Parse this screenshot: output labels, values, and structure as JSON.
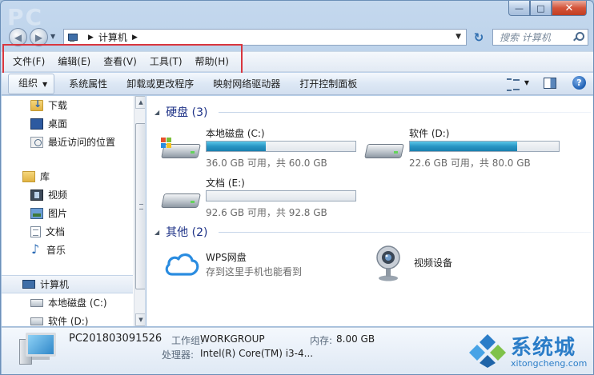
{
  "window": {
    "logo_text": "PC",
    "caption": {
      "minimize": "—",
      "maximize": "□",
      "close": "✕"
    }
  },
  "address": {
    "path": "计算机",
    "search_placeholder": "搜索 计算机"
  },
  "menu": [
    "文件(F)",
    "编辑(E)",
    "查看(V)",
    "工具(T)",
    "帮助(H)"
  ],
  "toolbar": {
    "organize": "组织",
    "commands": [
      "系统属性",
      "卸载或更改程序",
      "映射网络驱动器",
      "打开控制面板"
    ]
  },
  "nav": {
    "favorites": [
      {
        "label": "下载",
        "icon": "download-folder-icon"
      },
      {
        "label": "桌面",
        "icon": "desktop-icon"
      },
      {
        "label": "最近访问的位置",
        "icon": "recent-places-icon"
      }
    ],
    "library": {
      "label": "库",
      "icon": "library-icon"
    },
    "libraries": [
      {
        "label": "视频",
        "icon": "video-library-icon"
      },
      {
        "label": "图片",
        "icon": "pictures-library-icon"
      },
      {
        "label": "文档",
        "icon": "documents-library-icon"
      },
      {
        "label": "音乐",
        "icon": "music-library-icon"
      }
    ],
    "computer": {
      "label": "计算机",
      "icon": "computer-icon"
    },
    "drives": [
      {
        "label": "本地磁盘 (C:)",
        "icon": "drive-icon"
      },
      {
        "label": "软件 (D:)",
        "icon": "drive-icon"
      }
    ]
  },
  "groups": {
    "hard_disks": {
      "title": "硬盘 (3)"
    },
    "other": {
      "title": "其他 (2)"
    }
  },
  "drives": [
    {
      "name": "本地磁盘 (C:)",
      "free_text": "36.0 GB 可用，共 60.0 GB",
      "used_fraction": 0.4,
      "system": true
    },
    {
      "name": "软件 (D:)",
      "free_text": "22.6 GB 可用，共 80.0 GB",
      "used_fraction": 0.72,
      "system": false
    },
    {
      "name": "文档 (E:)",
      "free_text": "92.6 GB 可用，共 92.8 GB",
      "used_fraction": 0.002,
      "system": false
    }
  ],
  "other_items": [
    {
      "title": "WPS网盘",
      "subtitle": "存到这里手机也能看到",
      "icon": "cloud-icon"
    },
    {
      "title": "视频设备",
      "subtitle": "",
      "icon": "webcam-icon"
    }
  ],
  "details": {
    "pc_name": "PC201803091526",
    "workgroup_label": "工作组:",
    "workgroup_value": "WORKGROUP",
    "memory_label": "内存:",
    "memory_value": "8.00 GB",
    "processor_label": "处理器:",
    "processor_value": "Intel(R) Core(TM) i3-4..."
  },
  "watermark": {
    "name": "系统城",
    "url": "xitongcheng.com"
  },
  "colors": {
    "accent_bar": "#2996c4",
    "group_title": "#1e3287",
    "highlight_box": "#d9363e",
    "watermark": "#2b7dc8"
  }
}
